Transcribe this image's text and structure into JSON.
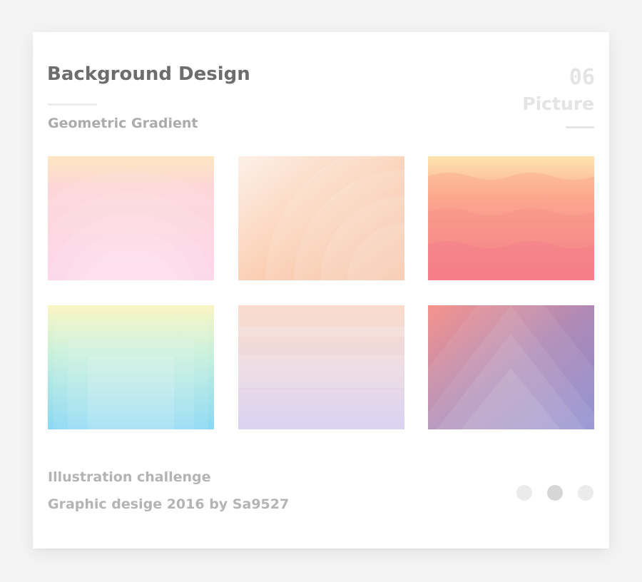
{
  "header": {
    "title": "Background Design",
    "subtitle": "Geometric Gradient",
    "count": "06",
    "count_label": "Picture"
  },
  "tiles": [
    {
      "name": "pink-concentric-arches",
      "colors": [
        "#fde4c0",
        "#fdd0e6"
      ]
    },
    {
      "name": "peach-quarter-circles",
      "colors": [
        "#fde9dc",
        "#f8b896"
      ]
    },
    {
      "name": "coral-waves",
      "colors": [
        "#fde0ae",
        "#f46d8c"
      ]
    },
    {
      "name": "mint-blue-nested-frames",
      "colors": [
        "#fbf4c4",
        "#8fdcf4"
      ]
    },
    {
      "name": "lavender-horizontal-bands",
      "colors": [
        "#fbdcce",
        "#d8d0f2"
      ]
    },
    {
      "name": "violet-triangles",
      "colors": [
        "#f4928e",
        "#8c8cd0"
      ]
    }
  ],
  "footer": {
    "line1": "Illustration challenge",
    "line2": "Graphic desige 2016 by Sa9527"
  },
  "pagination": {
    "count": 3,
    "active_index": 1
  }
}
